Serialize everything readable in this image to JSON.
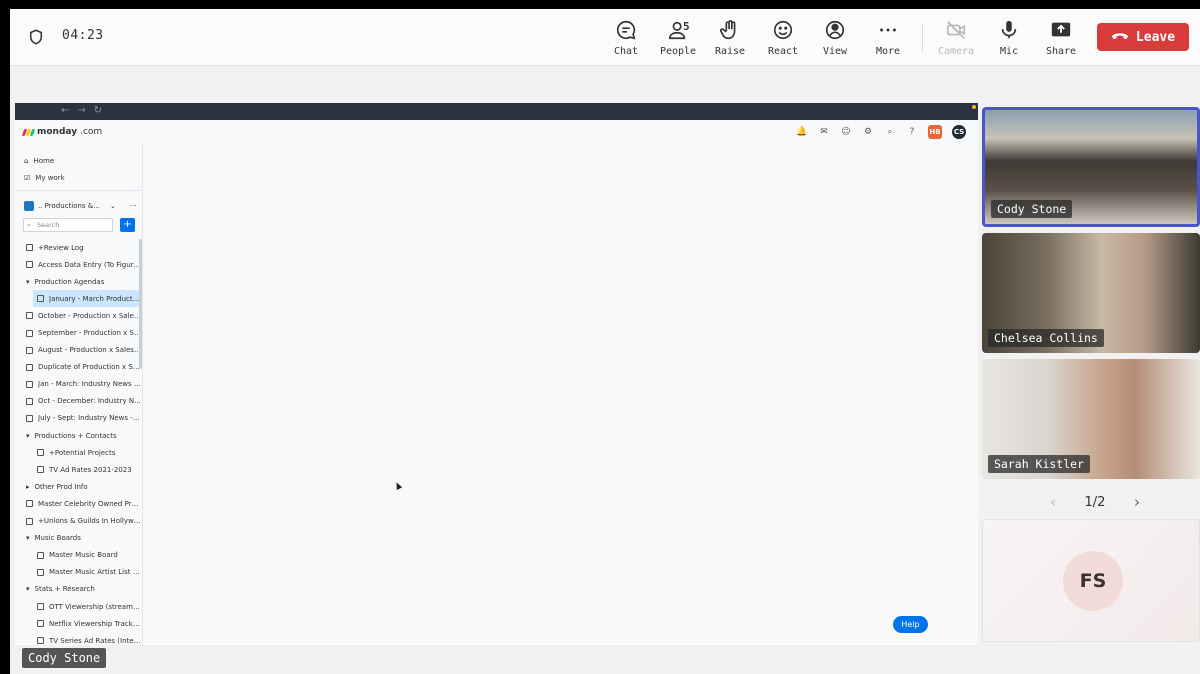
{
  "meeting": {
    "timer": "04:23",
    "controls": [
      {
        "id": "chat",
        "label": "Chat",
        "icon": "chat-icon"
      },
      {
        "id": "people",
        "label": "People",
        "icon": "people-icon",
        "count": "5"
      },
      {
        "id": "raise",
        "label": "Raise",
        "icon": "hand-icon"
      },
      {
        "id": "react",
        "label": "React",
        "icon": "smile-icon"
      },
      {
        "id": "view",
        "label": "View",
        "icon": "view-icon"
      },
      {
        "id": "more",
        "label": "More",
        "icon": "more-icon"
      },
      {
        "id": "camera",
        "label": "Camera",
        "icon": "camera-off-icon"
      },
      {
        "id": "mic",
        "label": "Mic",
        "icon": "mic-icon"
      },
      {
        "id": "share",
        "label": "Share",
        "icon": "share-icon"
      }
    ],
    "leave_label": "Leave",
    "leave_color": "#d93a3a",
    "active_speaker": "Cody Stone"
  },
  "browser": {
    "nav_glyphs": [
      "←",
      "→",
      "↻"
    ],
    "brand": {
      "name": "monday",
      "suffix": ".com"
    },
    "avatars": [
      "HB",
      "CS"
    ],
    "sidebar": {
      "home": "Home",
      "my_work": "My work",
      "workspace": ".. Productions &...",
      "workspace_menu": "···",
      "search_placeholder": "Search",
      "add": "+",
      "items": [
        {
          "label": "+Review Log",
          "indent": 0,
          "type": "board"
        },
        {
          "label": "Access Data Entry (To Figure...",
          "indent": 0,
          "type": "board"
        },
        {
          "label": "Production Agendas",
          "indent": 0,
          "type": "folder"
        },
        {
          "label": "January - March Producti...",
          "indent": 1,
          "type": "doc",
          "selected": true
        },
        {
          "label": "October - Production x Sales...",
          "indent": 0,
          "type": "doc"
        },
        {
          "label": "September - Production x Sa...",
          "indent": 0,
          "type": "doc"
        },
        {
          "label": "August - Production x Sales ...",
          "indent": 0,
          "type": "doc"
        },
        {
          "label": "Duplicate of Production x Sal...",
          "indent": 0,
          "type": "doc"
        },
        {
          "label": "Jan - March: Industry News - ...",
          "indent": 0,
          "type": "doc"
        },
        {
          "label": "Oct - December: Industry N...",
          "indent": 0,
          "type": "doc"
        },
        {
          "label": "July - Sept: Industry News - ...",
          "indent": 0,
          "type": "doc"
        },
        {
          "label": "Productions + Contacts",
          "indent": 0,
          "type": "folder"
        },
        {
          "label": "+Potential Projects",
          "indent": 1,
          "type": "board"
        },
        {
          "label": "TV Ad Rates 2021-2023",
          "indent": 1,
          "type": "board"
        },
        {
          "label": "Other Prod Info",
          "indent": 0,
          "type": "folder-closed"
        },
        {
          "label": "Master Celebrity Owned Pro...",
          "indent": 0,
          "type": "board"
        },
        {
          "label": "+Unions & Guilds In Hollywo...",
          "indent": 0,
          "type": "board"
        },
        {
          "label": "Music Boards",
          "indent": 0,
          "type": "folder"
        },
        {
          "label": "Master Music Board",
          "indent": 1,
          "type": "board"
        },
        {
          "label": "Master Music Artist List F...",
          "indent": 1,
          "type": "board"
        },
        {
          "label": "Stats + Research",
          "indent": 0,
          "type": "folder"
        },
        {
          "label": "OTT Viewership (streami...",
          "indent": 1,
          "type": "board"
        },
        {
          "label": "Netflix Viewership Tracki...",
          "indent": 1,
          "type": "board"
        },
        {
          "label": "TV Series Ad Rates (Inter...",
          "indent": 1,
          "type": "board"
        }
      ]
    },
    "help_label": "Help"
  },
  "participants": [
    {
      "name": "Cody Stone",
      "active": true
    },
    {
      "name": "Chelsea Collins"
    },
    {
      "name": "Sarah Kistler"
    }
  ],
  "pagination": {
    "label": "1/2"
  },
  "avatar_tile": {
    "initials": "FS"
  }
}
